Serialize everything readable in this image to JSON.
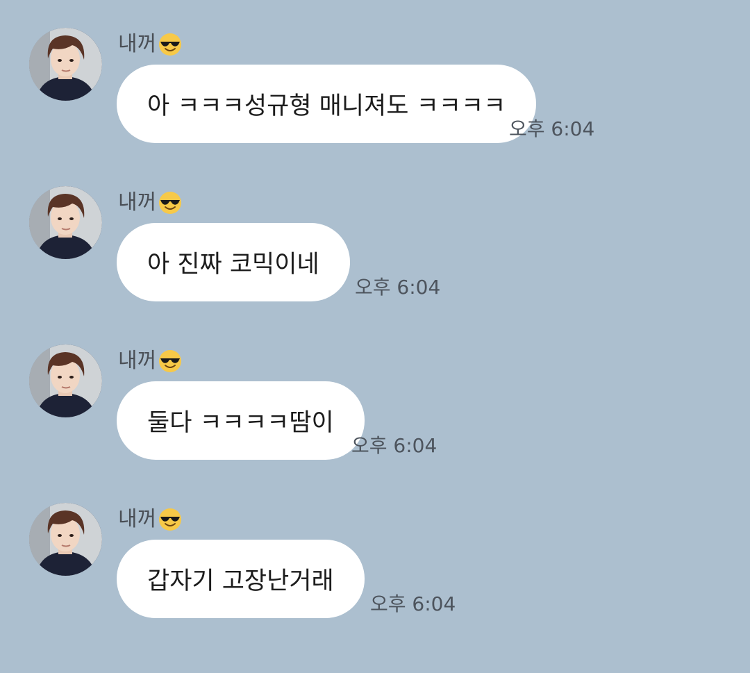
{
  "chat": {
    "background_color": "#acbfcf",
    "bubble_color": "#ffffff",
    "messages": [
      {
        "sender": "내꺼",
        "sender_emoji": "smiling-face-with-sunglasses-icon",
        "avatar": "profile-avatar",
        "text": "아 ㅋㅋㅋ성규형 매니져도 ㅋㅋㅋㅋ",
        "time": "오후 6:04"
      },
      {
        "sender": "내꺼",
        "sender_emoji": "smiling-face-with-sunglasses-icon",
        "avatar": "profile-avatar",
        "text": "아 진짜 코믹이네",
        "time": "오후 6:04"
      },
      {
        "sender": "내꺼",
        "sender_emoji": "smiling-face-with-sunglasses-icon",
        "avatar": "profile-avatar",
        "text": "둘다 ㅋㅋㅋㅋ땀이",
        "time": "오후 6:04"
      },
      {
        "sender": "내꺼",
        "sender_emoji": "smiling-face-with-sunglasses-icon",
        "avatar": "profile-avatar",
        "text": "갑자기 고장난거래",
        "time": "오후 6:04"
      }
    ]
  }
}
